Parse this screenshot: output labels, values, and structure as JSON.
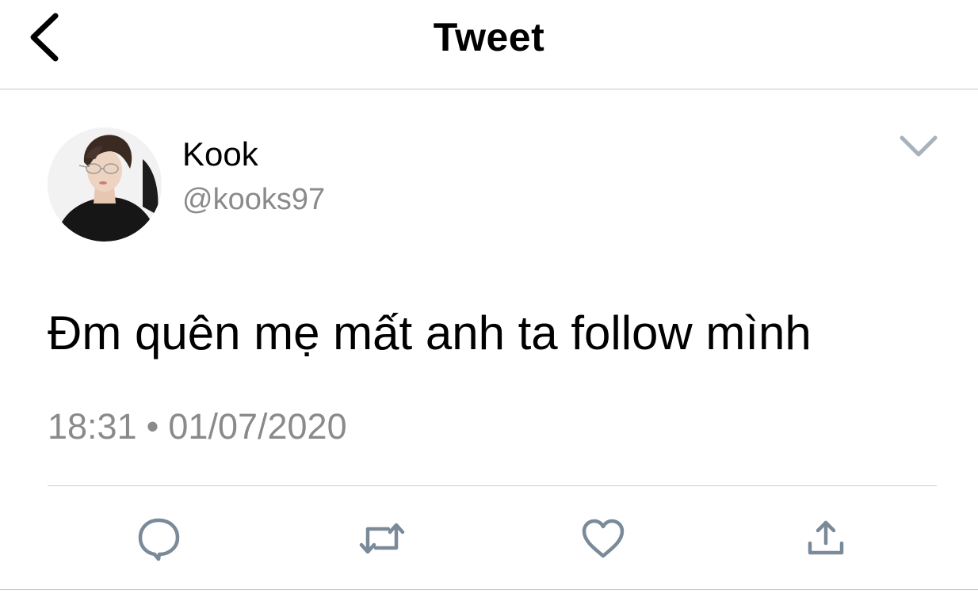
{
  "header": {
    "title": "Tweet",
    "back_icon": "chevron-left-icon"
  },
  "author": {
    "name": "Kook",
    "handle": "@kooks97",
    "avatar": "profile-photo"
  },
  "tweet": {
    "text": "Đm quên mẹ mất anh ta follow mình",
    "time": "18:31",
    "separator": "•",
    "date": "01/07/2020"
  },
  "actions": {
    "reply_icon": "reply-bubble-icon",
    "retweet_icon": "retweet-icon",
    "like_icon": "heart-icon",
    "share_icon": "share-icon",
    "more_icon": "chevron-down-icon"
  },
  "colors": {
    "text": "#000000",
    "secondary_text": "#8a8a8a",
    "icon": "#7a8a99",
    "divider": "#c8c8c8",
    "background": "#ffffff"
  }
}
